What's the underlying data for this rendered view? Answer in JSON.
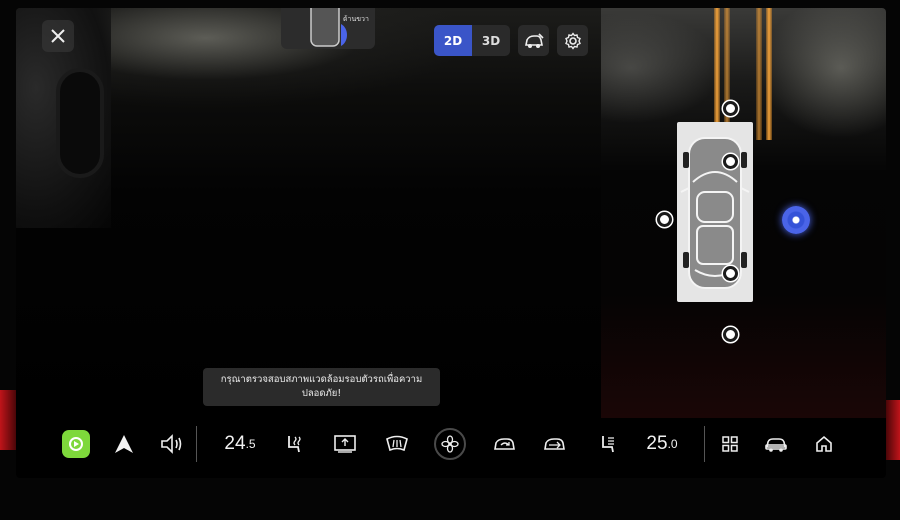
{
  "top": {
    "thumb_label": "ด้านขวา",
    "view_2d": "2D",
    "view_3d": "3D"
  },
  "toast": {
    "line1": "กรุณาตรวจสอบสภาพแวดล้อมรอบตัวรถเพื่อความ",
    "line2": "ปลอดภัย!"
  },
  "dock": {
    "temp_left_main": "24",
    "temp_left_dec": ".5",
    "temp_right_main": "25",
    "temp_right_dec": ".0"
  },
  "colors": {
    "accent": "#3a55c8",
    "guide_line": "#f3a23a",
    "carplay": "#7ed83b",
    "active_sensor": "#4a64e8"
  },
  "icons": [
    "close-icon",
    "car-view-icon",
    "settings-icon",
    "carplay-icon",
    "android-auto-icon",
    "volume-icon",
    "seat-heat-icon",
    "rear-defrost-icon",
    "front-defrost-icon",
    "fan-icon",
    "air-recirculation-icon",
    "fresh-air-icon",
    "seat-ventilation-icon",
    "apps-grid-icon",
    "car-icon",
    "home-icon"
  ]
}
